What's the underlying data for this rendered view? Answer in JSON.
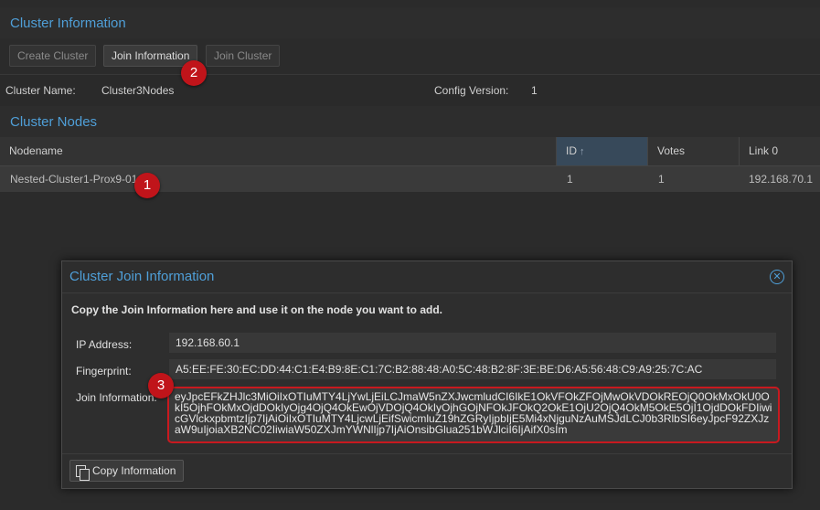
{
  "cluster_panel": {
    "title": "Cluster Information",
    "buttons": {
      "create": "Create Cluster",
      "join_info": "Join Information",
      "join": "Join Cluster"
    },
    "cluster_name_label": "Cluster Name:",
    "cluster_name": "Cluster3Nodes",
    "config_version_label": "Config Version:",
    "config_version": "1"
  },
  "nodes_panel": {
    "title": "Cluster Nodes",
    "columns": [
      "Nodename",
      "ID",
      "Votes",
      "Link 0"
    ],
    "sort_icon": "arrow-up-icon",
    "rows": [
      {
        "nodename": "Nested-Cluster1-Prox9-01",
        "id": "1",
        "votes": "1",
        "link0": "192.168.70.1"
      }
    ]
  },
  "annotations": [
    "1",
    "2",
    "3"
  ],
  "annotation_color": "#c0141a",
  "accent_color": "#4f9fd8",
  "dialog": {
    "title": "Cluster Join Information",
    "description": "Copy the Join Information here and use it on the node you want to add.",
    "ip_label": "IP Address:",
    "ip_value": "192.168.60.1",
    "fingerprint_label": "Fingerprint:",
    "fingerprint_value": "A5:EE:FE:30:EC:DD:44:C1:E4:B9:8E:C1:7C:B2:88:48:A0:5C:48:B2:8F:3E:BE:D6:A5:56:48:C9:A9:25:7C:AC",
    "join_label": "Join Information:",
    "join_value": "eyJpcEFkZHJlc3MiOiIxOTIuMTY4LjYwLjEiLCJmaW5nZXJwcmludCI6IkE1OkVFOkZFOjMwOkVDOkREOjQ0OkMxOkU0OkI5OjhFOkMxOjdDOkIyOjg4OjQ4OkEwOjVDOjQ4OkIyOjhGOjNFOkJFOkQ2OkE1OjU2OjQ4OkM5OkE5OjI1OjdDOkFDIiwicGVlckxpbmtzIjp7IjAiOiIxOTIuMTY4LjcwLjEifSwicmluZ19hZGRyIjpbIjE5Mi4xNjguNzAuMSJdLCJ0b3RlbSI6eyJpcF92ZXJzaW9uIjoiaXB2NC02IiwiaW50ZXJmYWNlIjp7IjAiOnsibGlua251bWJlciI6IjAifX0sIm",
    "copy_button": "Copy Information",
    "copy_icon": "copy-icon",
    "close_icon": "close-icon"
  }
}
